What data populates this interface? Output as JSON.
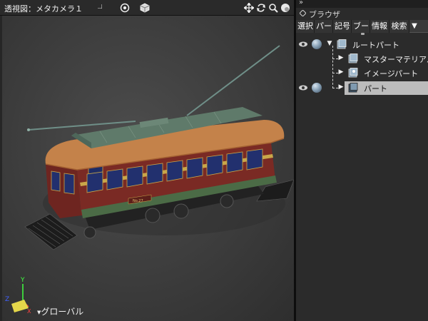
{
  "viewport": {
    "title": "透視図：メタカメラ１",
    "coordinate_mode": "グローバル",
    "axis_labels": {
      "x": "X",
      "y": "Y",
      "z": "Z"
    },
    "header_icons": [
      "display-mode-icon",
      "cube-view-icon",
      "pan-icon",
      "rotate-icon",
      "zoom-icon",
      "render-sphere-icon"
    ]
  },
  "browser": {
    "title": "ブラウザ",
    "collapse_glyph": "»",
    "tabs": [
      {
        "label": "選択",
        "width": 26
      },
      {
        "label": "パー",
        "width": 26
      },
      {
        "label": "記号",
        "width": 26
      },
      {
        "label": "ブー",
        "width": 26
      },
      {
        "label": "情報",
        "width": 27
      },
      {
        "label": "検索",
        "width": 28
      }
    ],
    "tabs_more_glyph": "▼",
    "tree": [
      {
        "label": "ルートパート",
        "disclosure": "▼",
        "level": 0,
        "visible": true,
        "selected": false
      },
      {
        "label": "マスターマテリアル",
        "disclosure": "▶",
        "level": 1,
        "visible": false,
        "selected": false
      },
      {
        "label": "イメージパート",
        "disclosure": "▶",
        "level": 1,
        "visible": false,
        "selected": false
      },
      {
        "label": "パート",
        "disclosure": "▶",
        "level": 1,
        "visible": true,
        "selected": true
      }
    ]
  },
  "colors": {
    "viewport_bg": "#434343",
    "panel_bg": "#2b2b2b",
    "selection_bg": "#bcbcbc",
    "tram_body": "#7a2a24",
    "tram_roof": "#c4824a",
    "tram_top": "#5f7a6a",
    "axis_x": "#ff4040",
    "axis_y": "#40ff40",
    "axis_z": "#4060ff"
  }
}
